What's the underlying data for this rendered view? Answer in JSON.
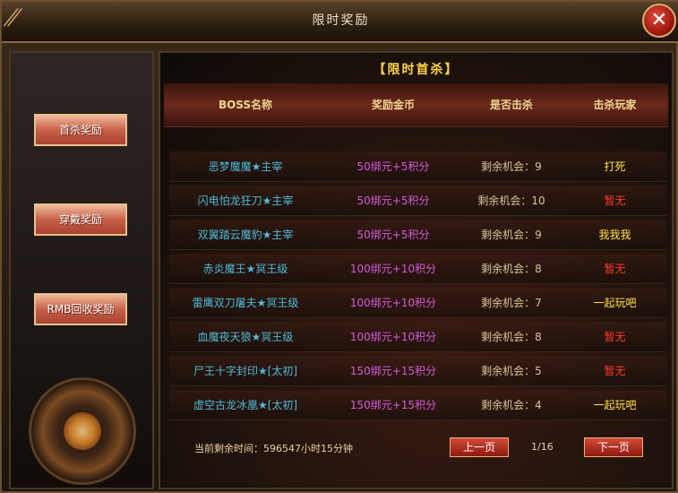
{
  "window": {
    "title": "限时奖励",
    "close_label": "✕"
  },
  "sidebar": {
    "items": [
      {
        "label": "首杀奖励"
      },
      {
        "label": "穿戴奖励"
      },
      {
        "label": "RMB回收奖励"
      }
    ]
  },
  "panel": {
    "subtitle": "【限时首杀】",
    "columns": [
      "BOSS名称",
      "奖励金币",
      "是否击杀",
      "击杀玩家"
    ],
    "rows": [
      {
        "name": "恶梦魔魔★主宰",
        "reward": "50绑元+5积分",
        "chance": "剩余机会：9",
        "killer": "打死",
        "killer_color": "#ffe24a"
      },
      {
        "name": "闪电怕龙狂刀★主宰",
        "reward": "50绑元+5积分",
        "chance": "剩余机会：10",
        "killer": "暂无",
        "killer_color": "#ff3b2a"
      },
      {
        "name": "双翼踏云魔豹★主宰",
        "reward": "50绑元+5积分",
        "chance": "剩余机会：9",
        "killer": "我我我",
        "killer_color": "#ffe24a"
      },
      {
        "name": "赤炎魔王★冥王级",
        "reward": "100绑元+10积分",
        "chance": "剩余机会：8",
        "killer": "暂无",
        "killer_color": "#ff3b2a"
      },
      {
        "name": "雷鹰双刀屠夫★冥王级",
        "reward": "100绑元+10积分",
        "chance": "剩余机会：7",
        "killer": "一起玩吧",
        "killer_color": "#ffe24a"
      },
      {
        "name": "血魔夜天狼★冥王级",
        "reward": "100绑元+10积分",
        "chance": "剩余机会：8",
        "killer": "暂无",
        "killer_color": "#ff3b2a"
      },
      {
        "name": "尸王十字封印★[太初]",
        "reward": "150绑元+15积分",
        "chance": "剩余机会：5",
        "killer": "暂无",
        "killer_color": "#ff3b2a"
      },
      {
        "name": "虚空古龙冰凰★[太初]",
        "reward": "150绑元+15积分",
        "chance": "剩余机会：4",
        "killer": "一起玩吧",
        "killer_color": "#ffe24a"
      }
    ]
  },
  "footer": {
    "time_label": "当前剩余时间：596547小时15分钟",
    "prev_label": "上一页",
    "page_info": "1/16",
    "next_label": "下一页"
  }
}
